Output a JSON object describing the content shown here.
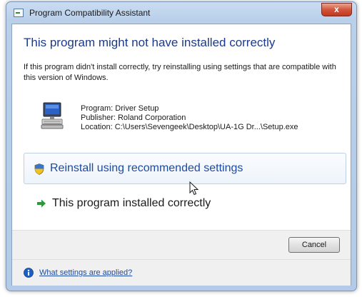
{
  "window": {
    "title": "Program Compatibility Assistant",
    "close_label": "x"
  },
  "main": {
    "heading": "This program might not have installed correctly",
    "message": "If this program didn't install correctly, try reinstalling using settings that are compatible with this version of Windows."
  },
  "program": {
    "icon": "computer-icon",
    "name": "Program: Driver Setup",
    "publisher": "Publisher: Roland Corporation",
    "location": "Location: C:\\Users\\Sevengeek\\Desktop\\UA-1G Dr...\\Setup.exe"
  },
  "options": {
    "reinstall": {
      "label": "Reinstall using recommended settings",
      "icon": "shield-icon"
    },
    "installed_correctly": {
      "label": "This program installed correctly",
      "icon": "green-arrow-icon"
    }
  },
  "buttons": {
    "cancel_label": "Cancel"
  },
  "footer": {
    "link_label": "What settings are applied?",
    "icon": "info-icon"
  },
  "colors": {
    "heading": "#1b3a8c",
    "link": "#1e4aa0",
    "close_button": "#c2371f",
    "arrow_green": "#2c9a3a"
  }
}
